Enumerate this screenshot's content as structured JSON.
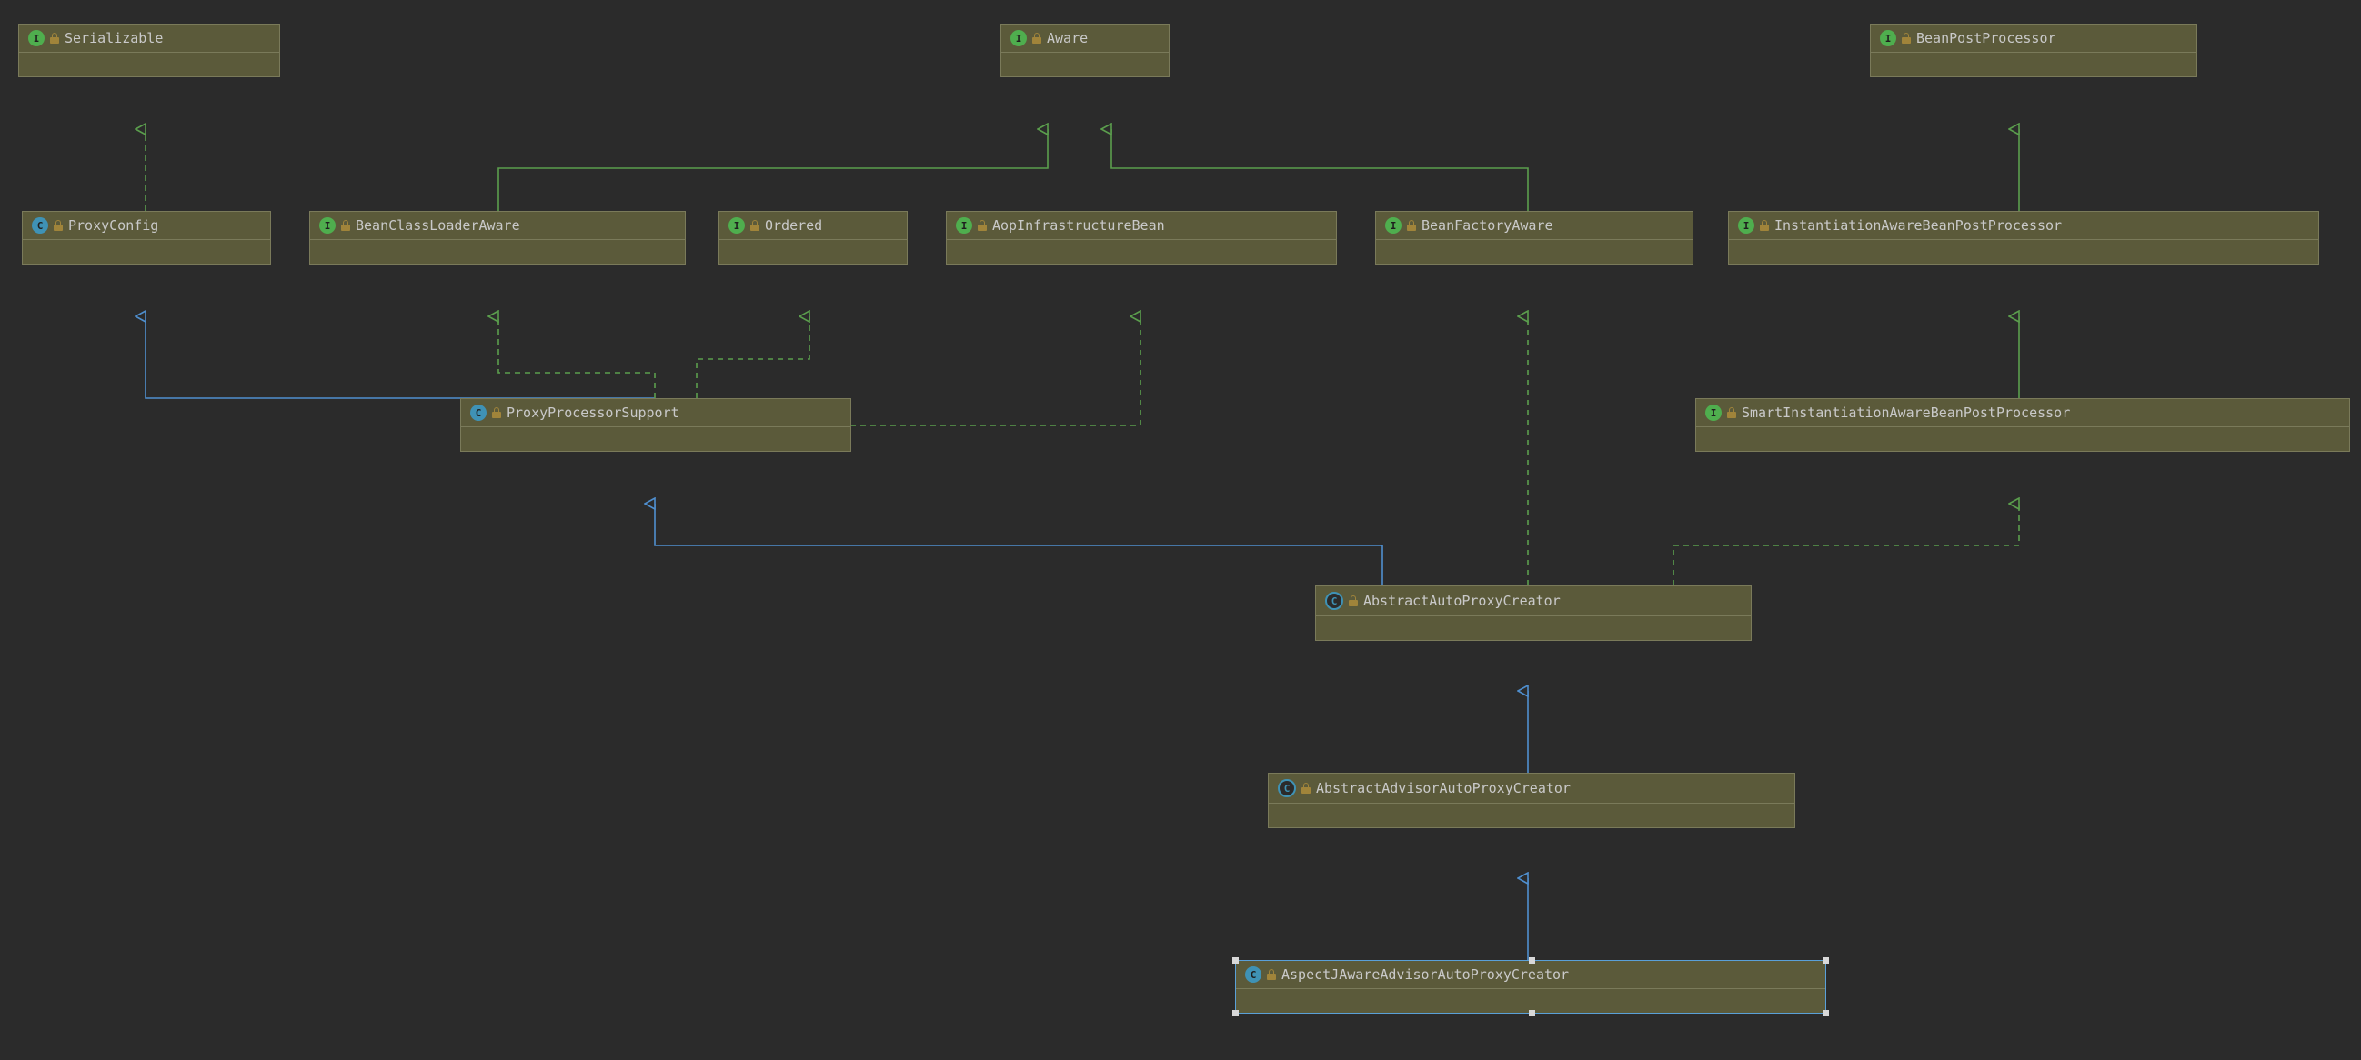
{
  "kind": "uml-class-diagram",
  "colors": {
    "background": "#2b2b2b",
    "node_fill": "#5b5a3a",
    "node_border": "#7a7a5a",
    "implements_arrow": "#5b9e4d",
    "extends_arrow": "#4f8fcf",
    "selection": "#5aa0d8"
  },
  "nodes": {
    "Serializable": {
      "type": "interface",
      "label": "Serializable"
    },
    "Aware": {
      "type": "interface",
      "label": "Aware"
    },
    "BeanPostProcessor": {
      "type": "interface",
      "label": "BeanPostProcessor"
    },
    "ProxyConfig": {
      "type": "class",
      "label": "ProxyConfig"
    },
    "BeanClassLoaderAware": {
      "type": "interface",
      "label": "BeanClassLoaderAware"
    },
    "Ordered": {
      "type": "interface",
      "label": "Ordered"
    },
    "AopInfrastructureBean": {
      "type": "interface",
      "label": "AopInfrastructureBean"
    },
    "BeanFactoryAware": {
      "type": "interface",
      "label": "BeanFactoryAware"
    },
    "InstantiationAwareBeanPostProcessor": {
      "type": "interface",
      "label": "InstantiationAwareBeanPostProcessor"
    },
    "ProxyProcessorSupport": {
      "type": "class",
      "label": "ProxyProcessorSupport"
    },
    "SmartInstantiationAwareBeanPostProcessor": {
      "type": "interface",
      "label": "SmartInstantiationAwareBeanPostProcessor"
    },
    "AbstractAutoProxyCreator": {
      "type": "abstract",
      "label": "AbstractAutoProxyCreator"
    },
    "AbstractAdvisorAutoProxyCreator": {
      "type": "abstract",
      "label": "AbstractAdvisorAutoProxyCreator"
    },
    "AspectJAwareAdvisorAutoProxyCreator": {
      "type": "class",
      "label": "AspectJAwareAdvisorAutoProxyCreator",
      "selected": true
    }
  },
  "relationships": [
    {
      "from": "ProxyConfig",
      "to": "Serializable",
      "kind": "implements"
    },
    {
      "from": "BeanClassLoaderAware",
      "to": "Aware",
      "kind": "extends-interface"
    },
    {
      "from": "BeanFactoryAware",
      "to": "Aware",
      "kind": "extends-interface"
    },
    {
      "from": "InstantiationAwareBeanPostProcessor",
      "to": "BeanPostProcessor",
      "kind": "extends-interface"
    },
    {
      "from": "ProxyProcessorSupport",
      "to": "ProxyConfig",
      "kind": "extends"
    },
    {
      "from": "ProxyProcessorSupport",
      "to": "BeanClassLoaderAware",
      "kind": "implements"
    },
    {
      "from": "ProxyProcessorSupport",
      "to": "Ordered",
      "kind": "implements"
    },
    {
      "from": "ProxyProcessorSupport",
      "to": "AopInfrastructureBean",
      "kind": "implements"
    },
    {
      "from": "SmartInstantiationAwareBeanPostProcessor",
      "to": "InstantiationAwareBeanPostProcessor",
      "kind": "extends-interface"
    },
    {
      "from": "AbstractAutoProxyCreator",
      "to": "ProxyProcessorSupport",
      "kind": "extends"
    },
    {
      "from": "AbstractAutoProxyCreator",
      "to": "BeanFactoryAware",
      "kind": "implements"
    },
    {
      "from": "AbstractAutoProxyCreator",
      "to": "SmartInstantiationAwareBeanPostProcessor",
      "kind": "implements"
    },
    {
      "from": "AbstractAdvisorAutoProxyCreator",
      "to": "AbstractAutoProxyCreator",
      "kind": "extends"
    },
    {
      "from": "AspectJAwareAdvisorAutoProxyCreator",
      "to": "AbstractAdvisorAutoProxyCreator",
      "kind": "extends"
    }
  ],
  "glyphs": {
    "interface": "I",
    "class": "C",
    "abstract": "C"
  }
}
